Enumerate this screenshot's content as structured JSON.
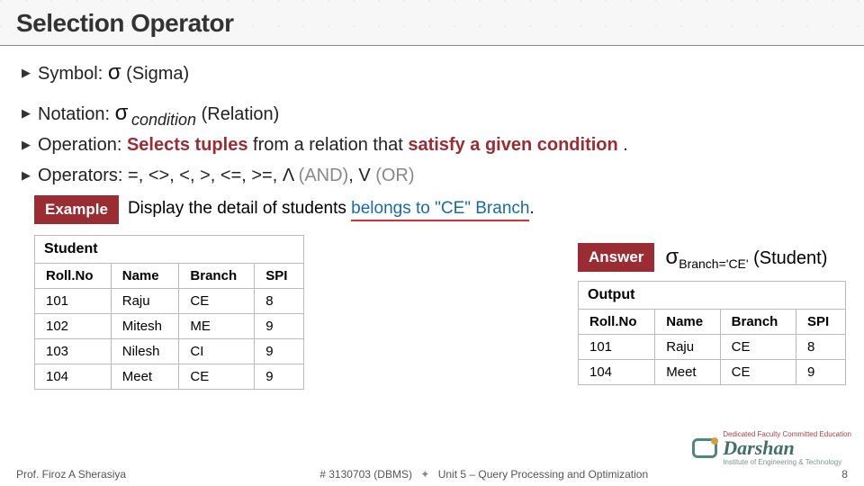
{
  "header": {
    "title": "Selection Operator"
  },
  "bullets": {
    "symbol_label": "Symbol: ",
    "symbol_sigma": "σ",
    "symbol_tail": " (Sigma)",
    "notation_label": "Notation: ",
    "notation_sigma": "σ",
    "notation_sub": "condition",
    "notation_tail": " (Relation)",
    "operation_label": "Operation: ",
    "operation_strong1": "Selects tuples",
    "operation_mid": "  from a relation that ",
    "operation_strong2": "satisfy a given condition",
    "operation_end": " .",
    "operators_label": "Operators:  =, <>, <, >, <=, >=, ",
    "operators_and": "Λ ",
    "operators_and_tail": "(AND)",
    "operators_sep": ", V ",
    "operators_or_tail": "(OR)"
  },
  "example": {
    "tag": "Example",
    "pre": "Display the detail of students ",
    "accent": "belongs to \"CE\" Branch",
    "post": "."
  },
  "answer": {
    "tag": "Answer",
    "sigma": "σ",
    "sub": "Branch='CE'",
    "tail": " (Student)"
  },
  "tables": {
    "student": {
      "title": "Student",
      "headers": [
        "Roll.No",
        "Name",
        "Branch",
        "SPI"
      ],
      "rows": [
        [
          "101",
          "Raju",
          "CE",
          "8"
        ],
        [
          "102",
          "Mitesh",
          "ME",
          "9"
        ],
        [
          "103",
          "Nilesh",
          "CI",
          "9"
        ],
        [
          "104",
          "Meet",
          "CE",
          "9"
        ]
      ]
    },
    "output": {
      "title": "Output",
      "headers": [
        "Roll.No",
        "Name",
        "Branch",
        "SPI"
      ],
      "rows": [
        [
          "101",
          "Raju",
          "CE",
          "8"
        ],
        [
          "104",
          "Meet",
          "CE",
          "9"
        ]
      ]
    }
  },
  "footer": {
    "left": "Prof. Firoz A Sherasiya",
    "code": "3130703 (DBMS)",
    "unit": "Unit 5 – Query Processing and Optimization",
    "page": "8"
  },
  "logo": {
    "tagline": "Dedicated Faculty Committed Education",
    "main": "Darshan",
    "sub": "Institute of Engineering & Technology"
  }
}
